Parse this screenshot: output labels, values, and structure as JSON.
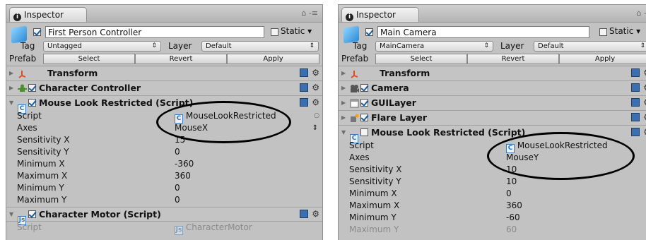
{
  "left": {
    "tab_title": "Inspector",
    "tab_tools": "⌂ -≡",
    "object_name": "First Person Controller",
    "static_label": "Static ▾",
    "tag_label": "Tag",
    "tag_value": "Untagged",
    "layer_label": "Layer",
    "layer_value": "Default",
    "prefab_label": "Prefab",
    "select_label": "Select",
    "revert_label": "Revert",
    "apply_label": "Apply",
    "components": [
      {
        "title": "Transform"
      },
      {
        "title": "Character Controller"
      },
      {
        "title": "Mouse Look Restricted (Script)"
      }
    ],
    "props": [
      {
        "k": "Script",
        "v": "MouseLookRestricted"
      },
      {
        "k": "Axes",
        "v": "MouseX"
      },
      {
        "k": "Sensitivity X",
        "v": "15"
      },
      {
        "k": "Sensitivity Y",
        "v": "0"
      },
      {
        "k": "Minimum X",
        "v": "-360"
      },
      {
        "k": "Maximum X",
        "v": "360"
      },
      {
        "k": "Minimum Y",
        "v": "0"
      },
      {
        "k": "Maximum Y",
        "v": "0"
      }
    ],
    "motor_title": "Character Motor (Script)",
    "motor_prop": {
      "k": "Script",
      "v": "CharacterMotor"
    }
  },
  "right": {
    "tab_title": "Inspector",
    "tab_tools": "⌂ -",
    "object_name": "Main Camera",
    "static_label": "Static ▾",
    "tag_label": "Tag",
    "tag_value": "MainCamera",
    "layer_label": "Layer",
    "layer_value": "Default",
    "prefab_label": "Prefab",
    "select_label": "Select",
    "revert_label": "Revert",
    "apply_label": "Apply",
    "components": [
      {
        "title": "Transform"
      },
      {
        "title": "Camera"
      },
      {
        "title": "GUILayer"
      },
      {
        "title": "Flare Layer"
      },
      {
        "title": "Mouse Look Restricted (Script)"
      }
    ],
    "props": [
      {
        "k": "Script",
        "v": "MouseLookRestricted"
      },
      {
        "k": "Axes",
        "v": "MouseY"
      },
      {
        "k": "Sensitivity X",
        "v": "10"
      },
      {
        "k": "Sensitivity Y",
        "v": "10"
      },
      {
        "k": "Minimum X",
        "v": "0"
      },
      {
        "k": "Maximum X",
        "v": "360"
      },
      {
        "k": "Minimum Y",
        "v": "-60"
      },
      {
        "k": "Maximum Y",
        "v": "60"
      }
    ]
  }
}
